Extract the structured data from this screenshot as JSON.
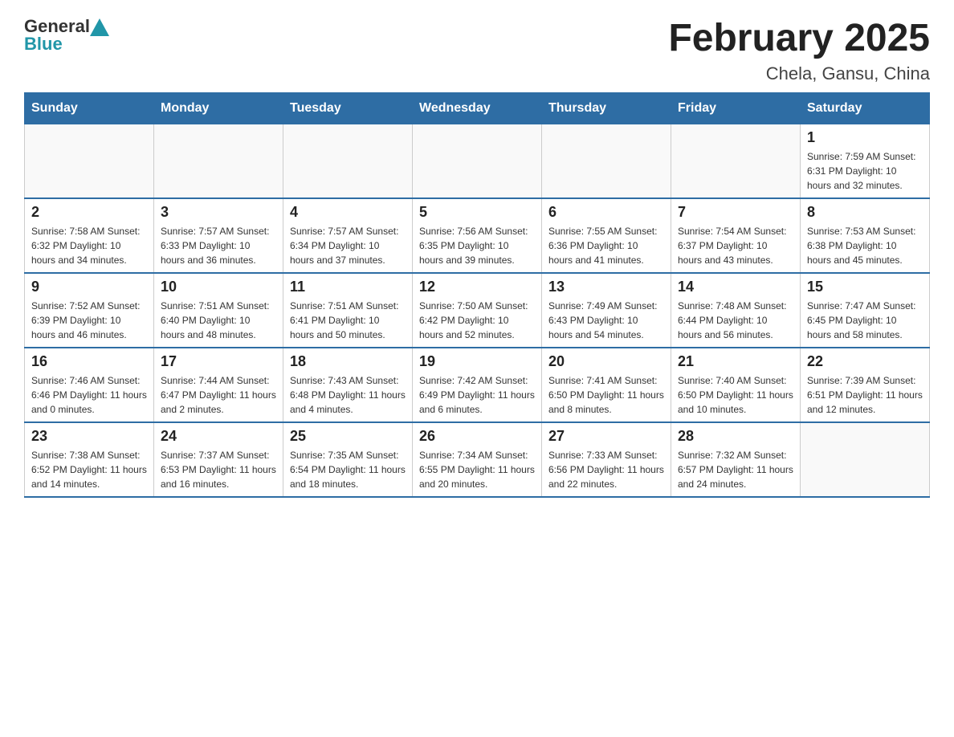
{
  "header": {
    "logo_general": "General",
    "logo_blue": "Blue",
    "title": "February 2025",
    "subtitle": "Chela, Gansu, China"
  },
  "days_of_week": [
    "Sunday",
    "Monday",
    "Tuesday",
    "Wednesday",
    "Thursday",
    "Friday",
    "Saturday"
  ],
  "weeks": [
    [
      {
        "day": "",
        "info": ""
      },
      {
        "day": "",
        "info": ""
      },
      {
        "day": "",
        "info": ""
      },
      {
        "day": "",
        "info": ""
      },
      {
        "day": "",
        "info": ""
      },
      {
        "day": "",
        "info": ""
      },
      {
        "day": "1",
        "info": "Sunrise: 7:59 AM\nSunset: 6:31 PM\nDaylight: 10 hours and 32 minutes."
      }
    ],
    [
      {
        "day": "2",
        "info": "Sunrise: 7:58 AM\nSunset: 6:32 PM\nDaylight: 10 hours and 34 minutes."
      },
      {
        "day": "3",
        "info": "Sunrise: 7:57 AM\nSunset: 6:33 PM\nDaylight: 10 hours and 36 minutes."
      },
      {
        "day": "4",
        "info": "Sunrise: 7:57 AM\nSunset: 6:34 PM\nDaylight: 10 hours and 37 minutes."
      },
      {
        "day": "5",
        "info": "Sunrise: 7:56 AM\nSunset: 6:35 PM\nDaylight: 10 hours and 39 minutes."
      },
      {
        "day": "6",
        "info": "Sunrise: 7:55 AM\nSunset: 6:36 PM\nDaylight: 10 hours and 41 minutes."
      },
      {
        "day": "7",
        "info": "Sunrise: 7:54 AM\nSunset: 6:37 PM\nDaylight: 10 hours and 43 minutes."
      },
      {
        "day": "8",
        "info": "Sunrise: 7:53 AM\nSunset: 6:38 PM\nDaylight: 10 hours and 45 minutes."
      }
    ],
    [
      {
        "day": "9",
        "info": "Sunrise: 7:52 AM\nSunset: 6:39 PM\nDaylight: 10 hours and 46 minutes."
      },
      {
        "day": "10",
        "info": "Sunrise: 7:51 AM\nSunset: 6:40 PM\nDaylight: 10 hours and 48 minutes."
      },
      {
        "day": "11",
        "info": "Sunrise: 7:51 AM\nSunset: 6:41 PM\nDaylight: 10 hours and 50 minutes."
      },
      {
        "day": "12",
        "info": "Sunrise: 7:50 AM\nSunset: 6:42 PM\nDaylight: 10 hours and 52 minutes."
      },
      {
        "day": "13",
        "info": "Sunrise: 7:49 AM\nSunset: 6:43 PM\nDaylight: 10 hours and 54 minutes."
      },
      {
        "day": "14",
        "info": "Sunrise: 7:48 AM\nSunset: 6:44 PM\nDaylight: 10 hours and 56 minutes."
      },
      {
        "day": "15",
        "info": "Sunrise: 7:47 AM\nSunset: 6:45 PM\nDaylight: 10 hours and 58 minutes."
      }
    ],
    [
      {
        "day": "16",
        "info": "Sunrise: 7:46 AM\nSunset: 6:46 PM\nDaylight: 11 hours and 0 minutes."
      },
      {
        "day": "17",
        "info": "Sunrise: 7:44 AM\nSunset: 6:47 PM\nDaylight: 11 hours and 2 minutes."
      },
      {
        "day": "18",
        "info": "Sunrise: 7:43 AM\nSunset: 6:48 PM\nDaylight: 11 hours and 4 minutes."
      },
      {
        "day": "19",
        "info": "Sunrise: 7:42 AM\nSunset: 6:49 PM\nDaylight: 11 hours and 6 minutes."
      },
      {
        "day": "20",
        "info": "Sunrise: 7:41 AM\nSunset: 6:50 PM\nDaylight: 11 hours and 8 minutes."
      },
      {
        "day": "21",
        "info": "Sunrise: 7:40 AM\nSunset: 6:50 PM\nDaylight: 11 hours and 10 minutes."
      },
      {
        "day": "22",
        "info": "Sunrise: 7:39 AM\nSunset: 6:51 PM\nDaylight: 11 hours and 12 minutes."
      }
    ],
    [
      {
        "day": "23",
        "info": "Sunrise: 7:38 AM\nSunset: 6:52 PM\nDaylight: 11 hours and 14 minutes."
      },
      {
        "day": "24",
        "info": "Sunrise: 7:37 AM\nSunset: 6:53 PM\nDaylight: 11 hours and 16 minutes."
      },
      {
        "day": "25",
        "info": "Sunrise: 7:35 AM\nSunset: 6:54 PM\nDaylight: 11 hours and 18 minutes."
      },
      {
        "day": "26",
        "info": "Sunrise: 7:34 AM\nSunset: 6:55 PM\nDaylight: 11 hours and 20 minutes."
      },
      {
        "day": "27",
        "info": "Sunrise: 7:33 AM\nSunset: 6:56 PM\nDaylight: 11 hours and 22 minutes."
      },
      {
        "day": "28",
        "info": "Sunrise: 7:32 AM\nSunset: 6:57 PM\nDaylight: 11 hours and 24 minutes."
      },
      {
        "day": "",
        "info": ""
      }
    ]
  ]
}
